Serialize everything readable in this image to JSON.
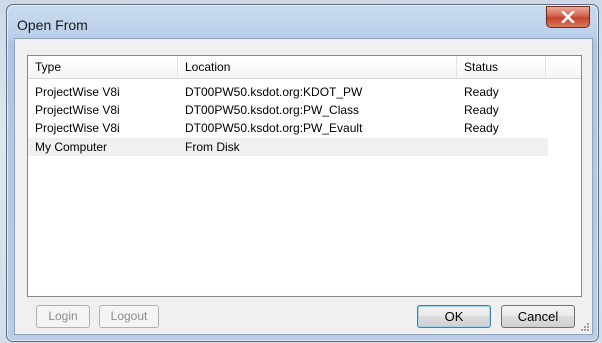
{
  "window": {
    "title": "Open From",
    "close_label": "X"
  },
  "list": {
    "columns": [
      "Type",
      "Location",
      "Status"
    ],
    "rows": [
      {
        "type": "ProjectWise V8i",
        "location": "DT00PW50.ksdot.org:KDOT_PW",
        "status": "Ready"
      },
      {
        "type": "ProjectWise V8i",
        "location": "DT00PW50.ksdot.org:PW_Class",
        "status": "Ready"
      },
      {
        "type": "ProjectWise V8i",
        "location": "DT00PW50.ksdot.org:PW_Evault",
        "status": "Ready"
      },
      {
        "type": "My Computer",
        "location": "From Disk",
        "status": ""
      }
    ]
  },
  "buttons": {
    "login": "Login",
    "logout": "Logout",
    "ok": "OK",
    "cancel": "Cancel"
  },
  "colors": {
    "close_button": "#c4422a",
    "window_frame": "#b9cde6",
    "selected_row": "#f0f0f0"
  }
}
